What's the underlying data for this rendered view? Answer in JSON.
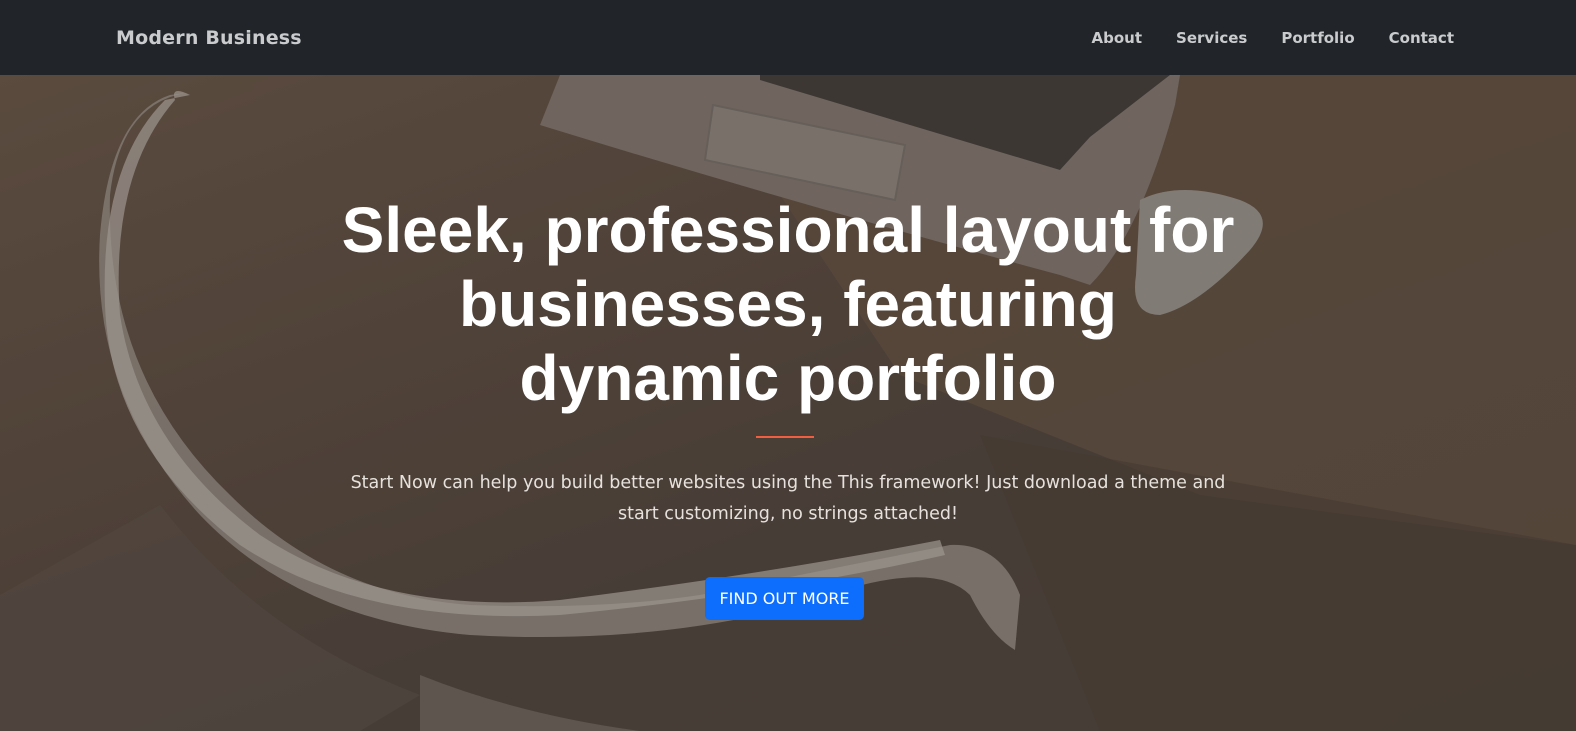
{
  "navbar": {
    "brand": "Modern Business",
    "links": [
      "About",
      "Services",
      "Portfolio",
      "Contact"
    ]
  },
  "hero": {
    "headline": "Sleek, professional layout for businesses, featuring dynamic portfolio",
    "lead": "Start Now can help you build better websites using the This framework! Just download a theme and start customizing, no strings attached!",
    "cta_label": "FIND OUT MORE"
  },
  "colors": {
    "navbar_bg": "#212529",
    "nav_text": "#c9cbcd",
    "divider": "#f05f40",
    "cta_bg": "#0d6efd"
  }
}
